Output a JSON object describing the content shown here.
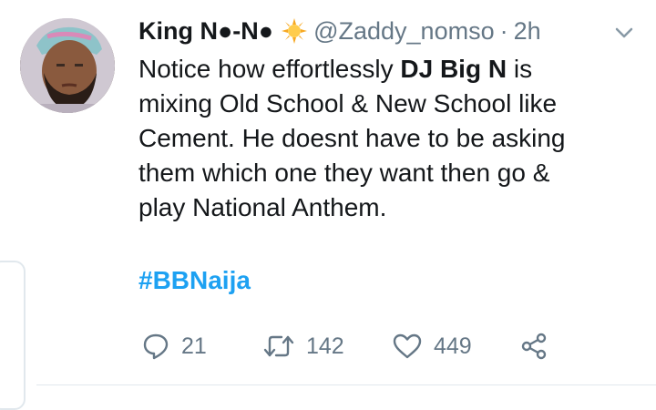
{
  "tweet": {
    "author": {
      "display_name": "King N●-N●",
      "badge_icon": "sun-emoji-icon",
      "handle": "@Zaddy_nomso",
      "separator": "·",
      "time": "2h"
    },
    "text_lines": {
      "line1_pre": "Notice how effortlessly ",
      "line1_bold": "DJ Big N",
      "line1_post": " is",
      "line2": "mixing Old School & New School like",
      "line3": "Cement. He doesnt have to be asking",
      "line4": "them which one they want then go &",
      "line5": "play National Anthem."
    },
    "hashtag": "#BBNaija",
    "actions": {
      "reply_count": "21",
      "retweet_count": "142",
      "like_count": "449"
    },
    "colors": {
      "link": "#1da1f2",
      "muted": "#657786",
      "text": "#14171a"
    }
  }
}
